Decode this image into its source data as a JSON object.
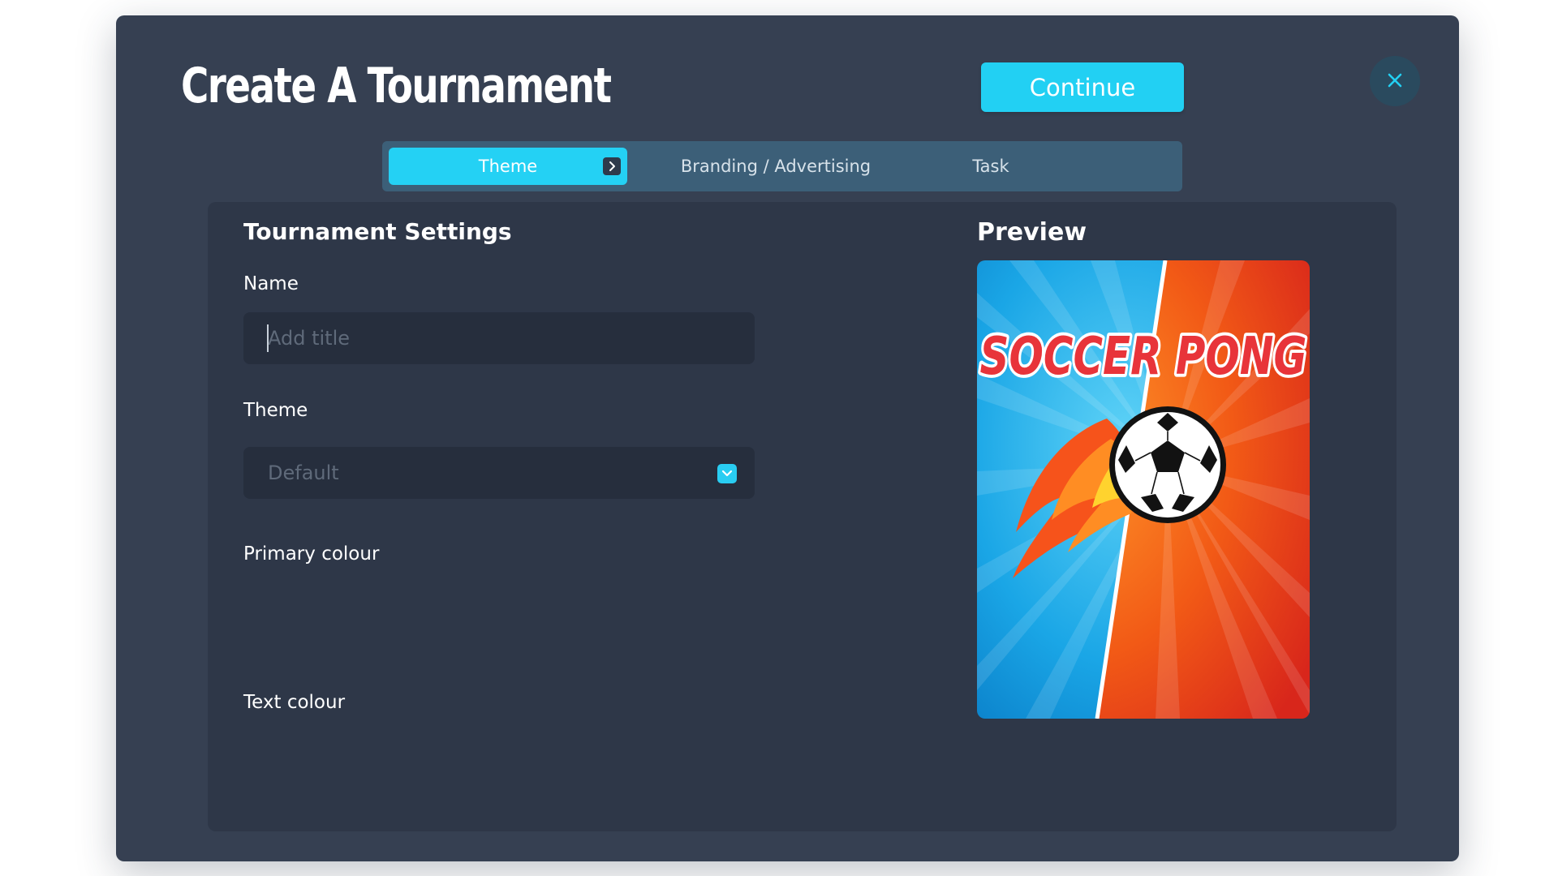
{
  "dialog": {
    "title": "Create A Tournament",
    "continue_label": "Continue",
    "close_icon": "close-icon"
  },
  "tabs": [
    {
      "label": "Theme",
      "active": true
    },
    {
      "label": "Branding / Advertising",
      "active": false
    },
    {
      "label": "Task",
      "active": false
    }
  ],
  "settings": {
    "heading": "Tournament Settings",
    "name": {
      "label": "Name",
      "value": "",
      "placeholder": "Add title"
    },
    "theme": {
      "label": "Theme",
      "value": "Default"
    },
    "primary_colour_label": "Primary colour",
    "text_colour_label": "Text colour"
  },
  "preview": {
    "heading": "Preview",
    "image_text": "SOCCER PONG"
  },
  "colors": {
    "accent": "#22d0f3",
    "modal_bg": "#364052",
    "panel_bg": "#2e3748",
    "tab_bar_bg": "#3c5f78",
    "input_bg": "#262e3d"
  }
}
